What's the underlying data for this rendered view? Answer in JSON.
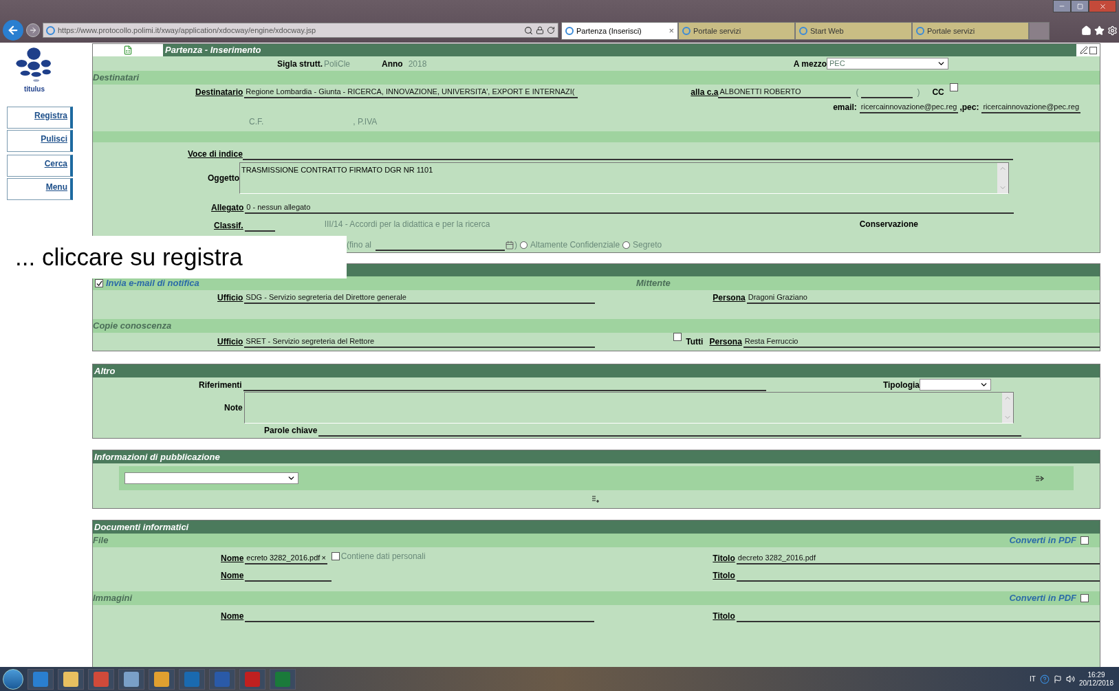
{
  "browser": {
    "url": "https://www.protocollo.polimi.it/xway/application/xdocway/engine/xdocway.jsp",
    "tabs": [
      {
        "label": "Partenza (Inserisci)",
        "selected": true,
        "close": "×"
      },
      {
        "label": "Portale servizi",
        "selected": false
      },
      {
        "label": "Start Web",
        "selected": false
      },
      {
        "label": "Portale servizi",
        "selected": false
      }
    ]
  },
  "sidebar": {
    "logo": "titulus",
    "buttons": [
      "Registra",
      "Pulisci",
      "Cerca",
      "Menu"
    ]
  },
  "form": {
    "title": "Partenza - Inserimento",
    "sigla_label": "Sigla strutt.",
    "sigla": "PoliCle",
    "anno_label": "Anno",
    "anno": "2018",
    "mezzo_label": "A mezzo",
    "mezzo": "PEC",
    "destinatari": "Destinatari",
    "destinatario_label": "Destinatario",
    "destinatario": "Regione Lombardia - Giunta - RICERCA, INNOVAZIONE, UNIVERSITA', EXPORT E INTERNAZI(",
    "alla_label": "alla c.a",
    "alla": "ALBONETTI ROBERTO",
    "paren_open": "(",
    "paren_close": ")",
    "cc_label": "CC",
    "cc_checked": false,
    "email_label": "email:",
    "email": "ricercainnovazione@pec.reg",
    "pec_label": ",pec:",
    "pec": "ricercainnovazione@pec.reg",
    "cf": "C.F.",
    "piva": ", P.IVA",
    "voce_label": "Voce di indice",
    "oggetto_label": "Oggetto",
    "oggetto": "TRASMISSIONE CONTRATTO FIRMATO DGR NR  1101",
    "allegato_label": "Allegato",
    "allegato": "0 - nessun allegato",
    "classif_label": "Classif.",
    "classif": "III/14 - Accordi per la didattica e per la ricerca",
    "conservazione": "Conservazione",
    "fino_al": "(fino al",
    "fino_close": ")",
    "radios": [
      {
        "label": "Altamente Confidenziale",
        "selected": false
      },
      {
        "label": "Segreto",
        "selected": false
      }
    ]
  },
  "overlay": "... cliccare su registra",
  "mittente_section": {
    "notify_label": "Invia e-mail di notifica",
    "notify_checked": true,
    "mittente": "Mittente",
    "ufficio_label": "Ufficio",
    "ufficio": "SDG - Servizio segreteria del Direttore generale",
    "persona_label": "Persona",
    "persona": "Dragoni Graziano",
    "copie": "Copie conoscenza",
    "ufficio2_label": "Ufficio",
    "ufficio2": "SRET - Servizio segreteria del Rettore",
    "tutti_label": "Tutti",
    "tutti_checked": false,
    "persona2_label": "Persona",
    "persona2": "Resta Ferruccio"
  },
  "altro": {
    "title": "Altro",
    "riferimenti_label": "Riferimenti",
    "tipologia_label": "Tipologia",
    "note_label": "Note",
    "parole_label": "Parole chiave"
  },
  "pubblicazione": {
    "title": "Informazioni di pubblicazione"
  },
  "documenti": {
    "title": "Documenti informatici",
    "file_title": "File",
    "file_converti": "Converti in PDF",
    "file_converti_checked": false,
    "files": [
      {
        "nome_label": "Nome",
        "nome": "ecreto 3282_2016.pdf",
        "remove": "×",
        "personal_label": "Contiene dati personali",
        "personal_checked": false,
        "titolo_label": "Titolo",
        "titolo": "decreto 3282_2016.pdf"
      },
      {
        "nome_label": "Nome",
        "titolo_label": "Titolo"
      }
    ],
    "img_title": "Immagini",
    "img_converti": "Converti in PDF",
    "img_converti_checked": false,
    "images": [
      {
        "nome_label": "Nome",
        "titolo_label": "Titolo"
      }
    ]
  },
  "taskbar": {
    "lang": "IT",
    "time": "16:29",
    "date": "20/12/2018"
  }
}
